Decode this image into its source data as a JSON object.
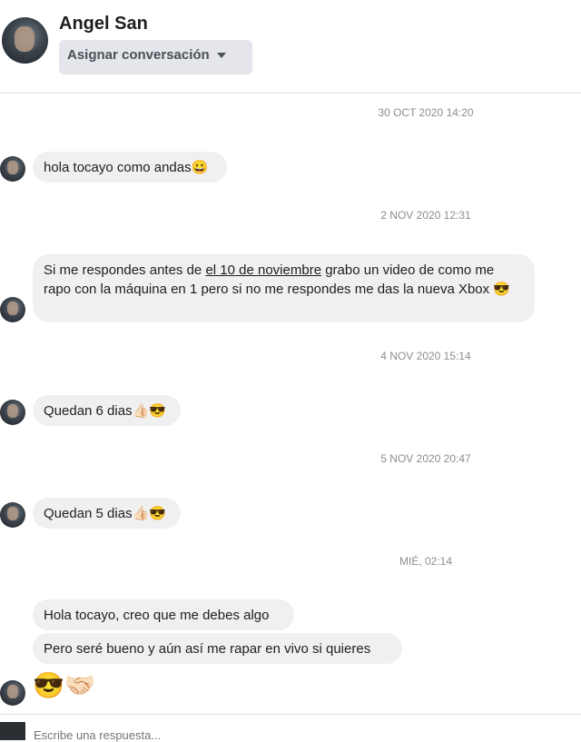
{
  "header": {
    "name": "Angel San",
    "assign_label": "Asignar conversación"
  },
  "messages": [
    {
      "timestamp": "30 OCT 2020 14:20",
      "text": "hola tocayo como andas😀"
    },
    {
      "timestamp": "2 NOV 2020 12:31",
      "text_before": "Si me respondes antes de ",
      "link": "el 10 de noviembre",
      "text_after": " grabo un video de como me rapo con la máquina en 1 pero si no me respondes me das la nueva Xbox 😎"
    },
    {
      "timestamp": "4 NOV 2020 15:14",
      "text": "Quedan 6 dias👍🏻😎"
    },
    {
      "timestamp": "5 NOV 2020 20:47",
      "text": "Quedan 5 dias👍🏻😎"
    },
    {
      "timestamp": "MIÉ, 02:14",
      "text": "Hola tocayo, creo que me debes algo",
      "text2": "Pero seré bueno y aún así me rapar en vivo si quieres",
      "emojis": "😎🤝🏻"
    }
  ],
  "composer": {
    "placeholder": "Escribe una respuesta..."
  }
}
